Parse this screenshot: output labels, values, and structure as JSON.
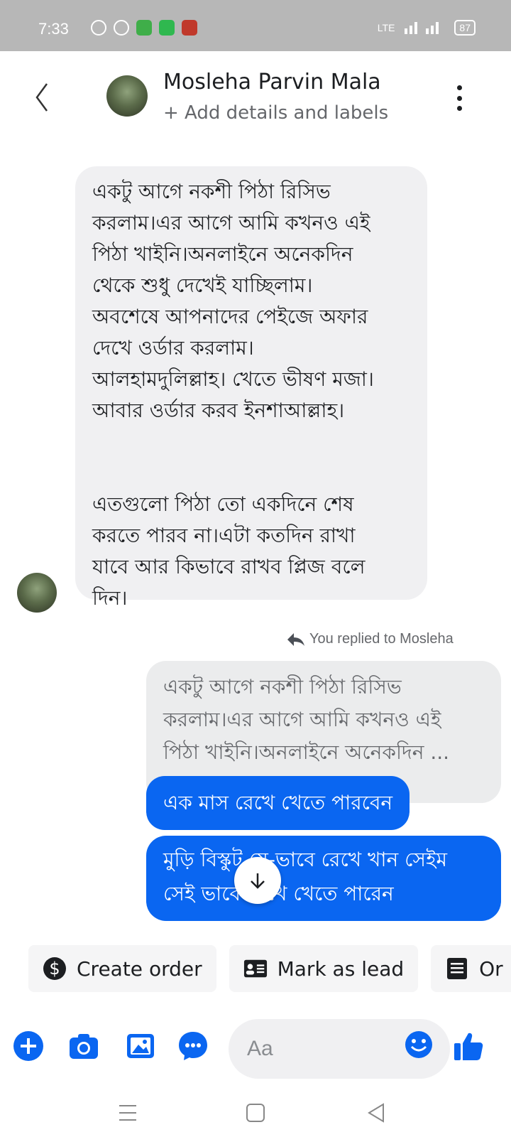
{
  "status": {
    "time": "7:33",
    "network": "LTE",
    "battery": "87"
  },
  "header": {
    "name": "Mosleha Parvin Mala",
    "subtitle": "+ Add details and labels"
  },
  "messages": {
    "incoming": "একটু আগে নকশী পিঠা রিসিভ\nকরলাম।এর আগে আমি কখনও এই\nপিঠা খাইনি।অনলাইনে অনেকদিন\nথেকে শুধু দেখেই যাচ্ছিলাম।\nঅবশেষে আপনাদের পেইজে অফার\nদেখে ওর্ডার করলাম।\nআলহামদুলিল্লাহ। খেতে ভীষণ মজা।\nআবার ওর্ডার করব ইনশাআল্লাহ।\n\n\nএতগুলো পিঠা তো একদিনে শেষ\nকরতে পারব না।এটা কতদিন রাখা\nযাবে আর কিভাবে রাখব প্লিজ বলে\nদিন।",
    "reply_label": "You replied to Mosleha",
    "quoted": "একটু আগে নকশী পিঠা রিসিভ\nকরলাম।এর আগে আমি কখনও এই\nপিঠা খাইনি।অনলাইনে অনেকদিন ...",
    "outgoing_1": "এক মাস রেখে খেতে পারবেন",
    "outgoing_2": "মুড়ি বিস্কুট যে-ভাবে রেখে খান সেইম\nসেই ভাবে রেখে খেতে পারেন"
  },
  "chips": [
    {
      "label": "Create order",
      "icon": "dollar-icon"
    },
    {
      "label": "Mark as lead",
      "icon": "contact-card-icon"
    },
    {
      "label": "Or",
      "icon": "list-icon"
    }
  ],
  "composer": {
    "placeholder": "Aa"
  },
  "colors": {
    "accent": "#0a66f1",
    "incoming_bubble": "#f0f0f2",
    "status_bar": "#b7b7b7"
  }
}
